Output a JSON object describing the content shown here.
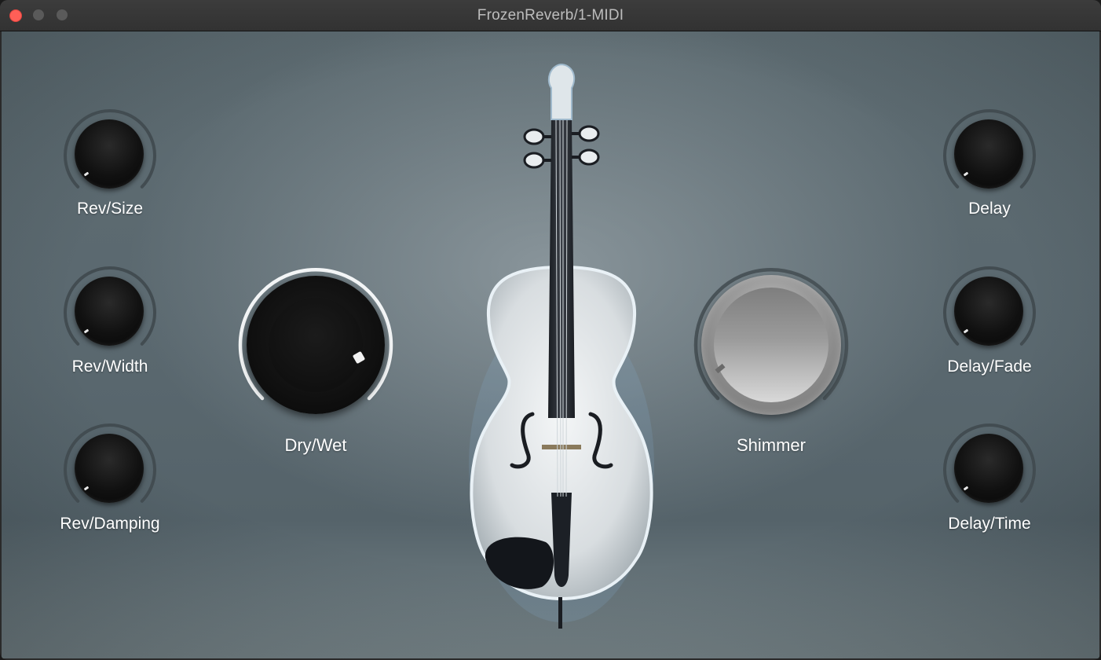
{
  "window": {
    "title": "FrozenReverb/1-MIDI"
  },
  "controls": {
    "left": [
      {
        "label": "Rev/Size",
        "value": 0
      },
      {
        "label": "Rev/Width",
        "value": 0
      },
      {
        "label": "Rev/Damping",
        "value": 0
      }
    ],
    "right": [
      {
        "label": "Delay",
        "value": 0
      },
      {
        "label": "Delay/Fade",
        "value": 0
      },
      {
        "label": "Delay/Time",
        "value": 0
      }
    ],
    "dry_wet": {
      "label": "Dry/Wet",
      "value": 1.0
    },
    "shimmer": {
      "label": "Shimmer",
      "value": 0
    }
  },
  "colors": {
    "accent": "#ffffff",
    "close_button": "#ff5f57",
    "knob_track": "#4a5459"
  },
  "icons": {
    "center_image": "violin-icon"
  }
}
